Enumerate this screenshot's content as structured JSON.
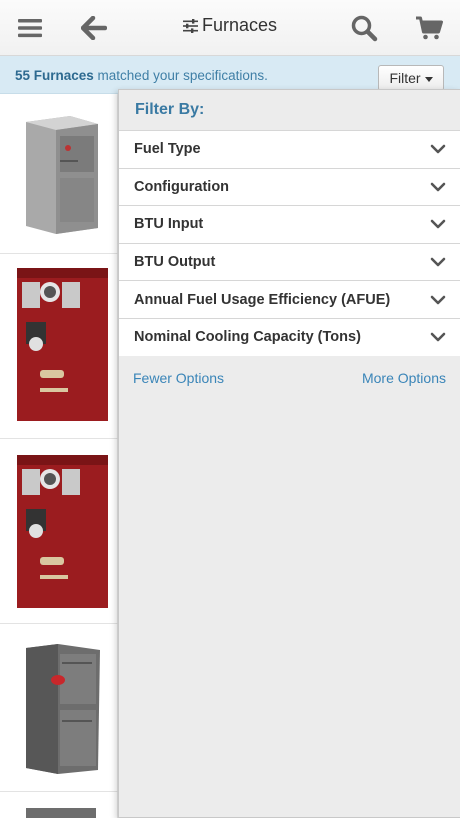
{
  "header": {
    "title": "Furnaces",
    "icons": {
      "menu": "menu-icon",
      "back": "back-arrow-icon",
      "filter": "tune-icon",
      "search": "search-icon",
      "cart": "cart-icon"
    }
  },
  "results": {
    "count": "55 Furnaces",
    "suffix": " matched your specifications.",
    "filter_label": "Filter"
  },
  "filter_panel": {
    "heading": "Filter By:",
    "options": [
      "Fuel Type",
      "Configuration",
      "BTU Input",
      "BTU Output",
      "Annual Fuel Usage Efficiency (AFUE)",
      "Nominal Cooling Capacity (Tons)"
    ],
    "fewer_options": "Fewer Options",
    "more_options": "More Options"
  },
  "colors": {
    "accent": "#3a7aa3",
    "banner_bg": "#d8eaf4",
    "panel_bg": "#ececec",
    "product_red": "#9b1c1f",
    "product_gray": "#7d7d7d"
  }
}
